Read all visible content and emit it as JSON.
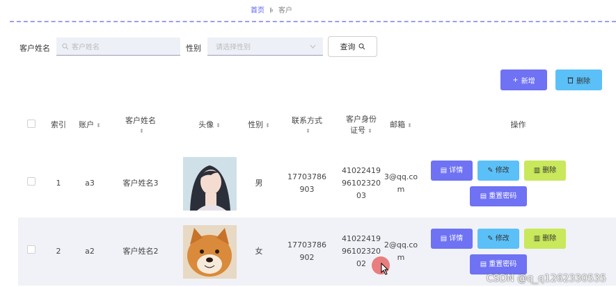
{
  "breadcrumb": {
    "home": "首页",
    "current": "客户"
  },
  "search": {
    "name_label": "客户姓名",
    "name_placeholder": "客户姓名",
    "gender_label": "性别",
    "gender_placeholder": "请选择性别",
    "query_label": "查询"
  },
  "toolbar": {
    "add_label": "新增",
    "delete_label": "删除"
  },
  "table": {
    "columns": [
      "索引",
      "账户",
      "客户姓名",
      "头像",
      "性别",
      "联系方式",
      "客户身份证号",
      "邮箱",
      "操作"
    ],
    "col_name_1": "客户姓名",
    "col_idcard_1": "客户身份",
    "col_idcard_2": "证号",
    "rows": [
      {
        "index": "1",
        "account": "a3",
        "name": "客户姓名3",
        "avatar": "girl-portrait",
        "gender": "男",
        "phone_1": "17703786",
        "phone_2": "903",
        "idcard_1": "41022419",
        "idcard_2": "96102320",
        "idcard_3": "03",
        "email_1": "3@qq.co",
        "email_2": "m"
      },
      {
        "index": "2",
        "account": "a2",
        "name": "客户姓名2",
        "avatar": "shiba-dog",
        "gender": "女",
        "phone_1": "17703786",
        "phone_2": "902",
        "idcard_1": "41022419",
        "idcard_2": "96102320",
        "idcard_3": "02",
        "email_1": "2@qq.co",
        "email_2": "m"
      }
    ],
    "actions": {
      "detail": "详情",
      "edit": "修改",
      "delete": "删除",
      "reset": "重置密码"
    }
  },
  "watermark": "CSDN @q_q1262330535",
  "colors": {
    "primary": "#6e72f3",
    "info": "#5bc0f7",
    "warning": "#c9e85b"
  }
}
